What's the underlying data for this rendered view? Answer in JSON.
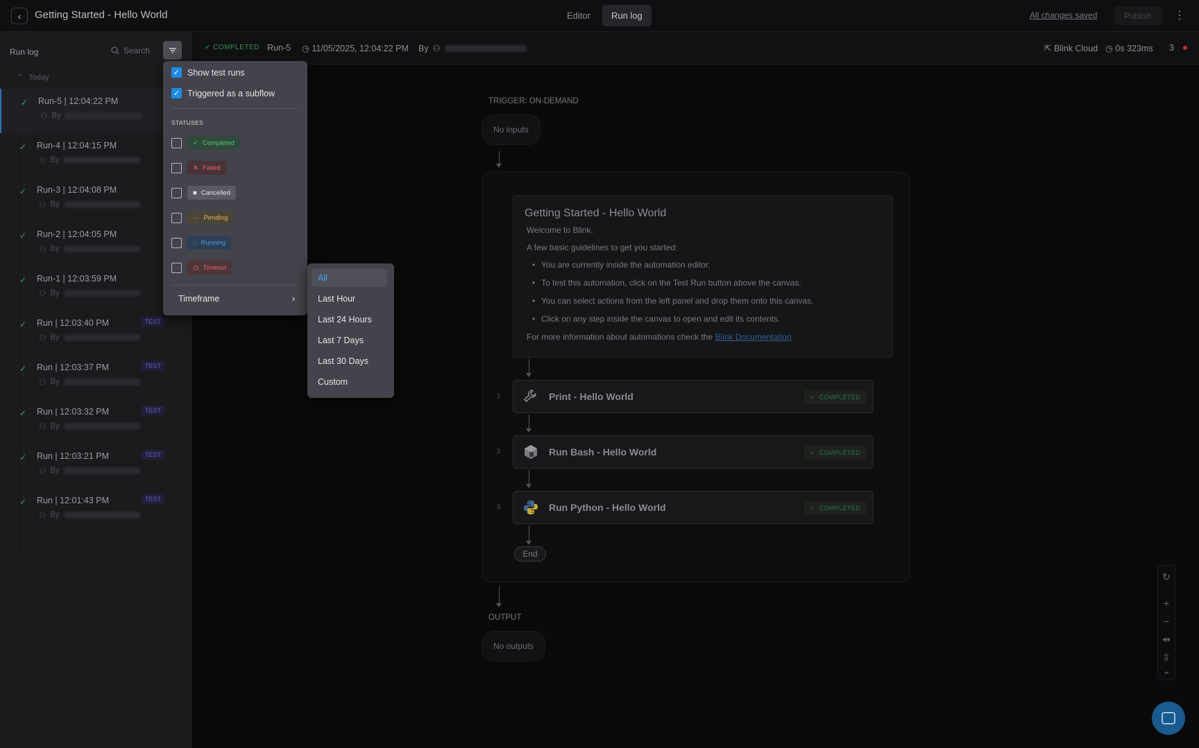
{
  "app": {
    "title": "Getting Started - Hello World",
    "tabs": [
      {
        "label": "Editor",
        "active": false
      },
      {
        "label": "Run log",
        "active": true
      }
    ],
    "saved_status": "All changes saved",
    "publish_label": "Publish"
  },
  "run_log": {
    "header": "Run log",
    "search_placeholder": "Search",
    "group_label": "Today",
    "by_label": "By",
    "test_badge": "TEST",
    "runs": [
      {
        "name": "Run-5  |  12:04:22 PM",
        "test": false,
        "active": true
      },
      {
        "name": "Run-4  |  12:04:15 PM",
        "test": false,
        "active": false
      },
      {
        "name": "Run-3  |  12:04:08 PM",
        "test": false,
        "active": false
      },
      {
        "name": "Run-2  |  12:04:05 PM",
        "test": false,
        "active": false
      },
      {
        "name": "Run-1  |  12:03:59 PM",
        "test": false,
        "active": false
      },
      {
        "name": "Run  |  12:03:40 PM",
        "test": true,
        "active": false
      },
      {
        "name": "Run  |  12:03:37 PM",
        "test": true,
        "active": false
      },
      {
        "name": "Run  |  12:03:32 PM",
        "test": true,
        "active": false
      },
      {
        "name": "Run  |  12:03:21 PM",
        "test": true,
        "active": false
      },
      {
        "name": "Run  |  12:01:43 PM",
        "test": true,
        "active": false
      }
    ]
  },
  "run_header": {
    "status": "COMPLETED",
    "run_name": "Run-5",
    "timestamp": "11/05/2025, 12:04:22 PM",
    "by_label": "By",
    "runner": "Blink Cloud",
    "duration": "0s 323ms",
    "count": "3",
    "status_color": "#3a9156"
  },
  "canvas": {
    "trigger_label": "TRIGGER: ON-DEMAND",
    "no_inputs": "No inputs",
    "note": {
      "title": "Getting Started - Hello World",
      "welcome": "Welcome to Blink.",
      "intro": "A few basic guidelines to get you started:",
      "bullets": [
        "You are currently inside the automation editor.",
        "To test this automation, click on the Test Run button above the canvas.",
        "You can select actions from the left panel and drop them onto this canvas.",
        "Click on any step inside the canvas to open and edit its contents."
      ],
      "more_info": "For more information about automations check the ",
      "link_text": "Blink Documentation"
    },
    "steps": [
      {
        "num": "1",
        "title": "Print - Hello World",
        "status": "COMPLETED",
        "icon": "wrench-icon"
      },
      {
        "num": "2",
        "title": "Run Bash - Hello World",
        "status": "COMPLETED",
        "icon": "bash-icon"
      },
      {
        "num": "3",
        "title": "Run Python - Hello World",
        "status": "COMPLETED",
        "icon": "python-icon"
      }
    ],
    "end_label": "End",
    "output_label": "OUTPUT",
    "no_outputs": "No outputs"
  },
  "filter_menu": {
    "show_test_runs": {
      "label": "Show test runs",
      "checked": true
    },
    "subflow": {
      "label": "Triggered as a subflow",
      "checked": true
    },
    "statuses_heading": "STATUSES",
    "statuses": [
      {
        "label": "Completed",
        "checked": false,
        "color": "#58c47e"
      },
      {
        "label": "Failed",
        "checked": false,
        "color": "#e36a6d"
      },
      {
        "label": "Cancelled",
        "checked": false,
        "color": "#e2e2e6"
      },
      {
        "label": "Pending",
        "checked": false,
        "color": "#e0b45a"
      },
      {
        "label": "Running",
        "checked": false,
        "color": "#4a9be4"
      },
      {
        "label": "Timeout",
        "checked": false,
        "color": "#e1666d"
      }
    ],
    "timeframe_label": "Timeframe"
  },
  "timeframe_menu": {
    "selected": "All",
    "options": [
      "All",
      "Last Hour",
      "Last 24 Hours",
      "Last 7 Days",
      "Last 30 Days",
      "Custom"
    ]
  }
}
